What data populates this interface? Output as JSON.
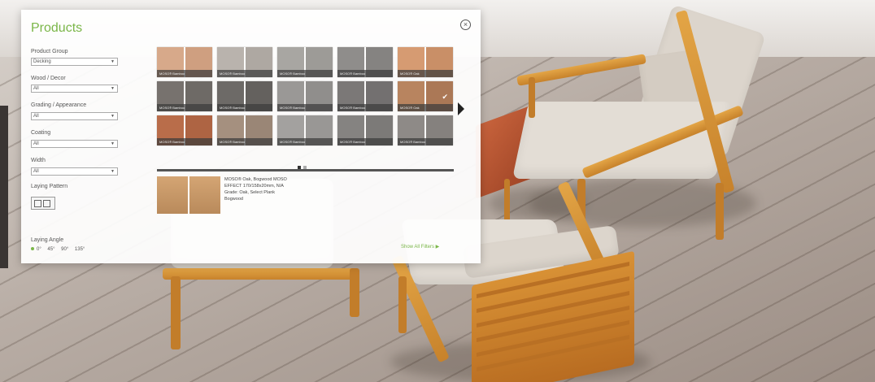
{
  "panel": {
    "title": "Products",
    "close_icon": "close-circle-icon",
    "product_group": {
      "label": "Product Group",
      "value": "Decking"
    },
    "wood_decor": {
      "label": "Wood / Decor",
      "value": "All"
    },
    "grading": {
      "label": "Grading / Appearance",
      "value": "All"
    },
    "coating": {
      "label": "Coating",
      "value": "All"
    },
    "width": {
      "label": "Width",
      "value": "All"
    },
    "laying_pattern": {
      "label": "Laying Pattern"
    },
    "laying_angle": {
      "label": "Laying Angle",
      "options": [
        "0°",
        "45°",
        "90°",
        "135°"
      ]
    },
    "show_all": "Show All Filters ▶"
  },
  "swatches": [
    {
      "label": "MOSO® Bamboo",
      "color": "#d7a98a",
      "color2": "#cf9f80"
    },
    {
      "label": "MOSO® Bamboo",
      "color": "#b9b3ad",
      "color2": "#aea8a2"
    },
    {
      "label": "MOSO® Bamboo",
      "color": "#a8a6a2",
      "color2": "#9d9b97"
    },
    {
      "label": "MOSO® Bamboo",
      "color": "#8f8d8b",
      "color2": "#858381"
    },
    {
      "label": "MOSO® Oak",
      "color": "#d69b72",
      "color2": "#c98f67"
    },
    {
      "label": "MOSO® Bamboo",
      "color": "#77726e",
      "color2": "#6e6a66"
    },
    {
      "label": "MOSO® Bamboo",
      "color": "#6d6a67",
      "color2": "#64615e"
    },
    {
      "label": "MOSO® Bamboo",
      "color": "#9a9896",
      "color2": "#908e8c"
    },
    {
      "label": "MOSO® Bamboo",
      "color": "#7b7877",
      "color2": "#737070"
    },
    {
      "label": "MOSO® Oak",
      "color": "#b8845f",
      "color2": "#ab7856",
      "selected": true
    },
    {
      "label": "MOSO® Bamboo",
      "color": "#b96d4a",
      "color2": "#ae6443"
    },
    {
      "label": "MOSO® Bamboo",
      "color": "#a5907f",
      "color2": "#9a8676"
    },
    {
      "label": "MOSO® Bamboo",
      "color": "#a3a19f",
      "color2": "#999795"
    },
    {
      "label": "MOSO® Bamboo",
      "color": "#858381",
      "color2": "#7c7a78"
    },
    {
      "label": "MOSO® Bamboo",
      "color": "#8e8a87",
      "color2": "#85817e"
    }
  ],
  "pager": {
    "pages": 2,
    "active": 1
  },
  "detail": {
    "lines": [
      "MOSO® Oak, Bogwood MOSO",
      "EFFECT 170/158x20mm, N/A",
      "Grade: Oak, Select Plank",
      "Bogwood"
    ]
  },
  "colors": {
    "accent": "#7ab648"
  }
}
